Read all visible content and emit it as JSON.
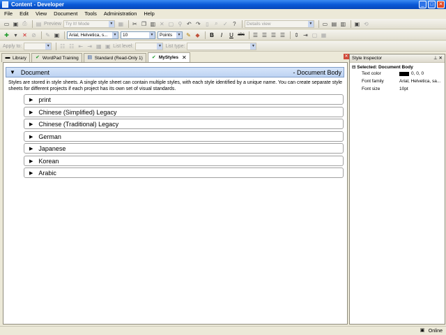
{
  "window": {
    "title": "Content - Developer",
    "buttons": {
      "minimize": "_",
      "maximize": "□",
      "close": "✕"
    }
  },
  "menu": [
    "File",
    "Edit",
    "View",
    "Document",
    "Tools",
    "Administration",
    "Help"
  ],
  "toolbar": {
    "preview_label": "Preview",
    "mode_value": "Try It! Mode",
    "view_value": "Details view",
    "font_family": "Arial, Helvetica, s...",
    "font_size": "10",
    "size_unit": "Points",
    "bold": "B",
    "italic": "I",
    "underline": "U",
    "strike": "abc",
    "apply_to_label": "Apply to:",
    "list_level_label": "List level:",
    "list_type_label": "List type:"
  },
  "tabs": [
    {
      "label": "Library",
      "icon": "library-icon"
    },
    {
      "label": "WordPad Training",
      "icon": "check-icon"
    },
    {
      "label": "Standard (Read-Only 1)",
      "icon": "document-icon"
    },
    {
      "label": "MyStyles",
      "icon": "check-icon"
    }
  ],
  "editor": {
    "header_title": "Document",
    "header_style": "- Document Body",
    "description": "Styles are stored in style sheets. A single style sheet can contain multiple styles, with each style identified by a unique name. You can create separate style sheets for different projects if each project has its own set of visual standards.",
    "sections": [
      "print",
      "Chinese (Simplified) Legacy",
      "Chinese (Traditional) Legacy",
      "German",
      "Japanese",
      "Korean",
      "Arabic"
    ]
  },
  "inspector": {
    "title": "Style Inspector",
    "section": "Selected: Document Body",
    "properties": [
      {
        "name": "Text color",
        "value": "0, 0, 0"
      },
      {
        "name": "Font family",
        "value": "Arial, Helvetica, sa..."
      },
      {
        "name": "Font size",
        "value": "10pt"
      }
    ],
    "text_color_swatch": "#000000"
  },
  "status": {
    "text": "Online"
  },
  "colors": {
    "title_bar": "#0a5ad8",
    "header_blue": "#bdd3f2",
    "close_red": "#e04a24"
  }
}
